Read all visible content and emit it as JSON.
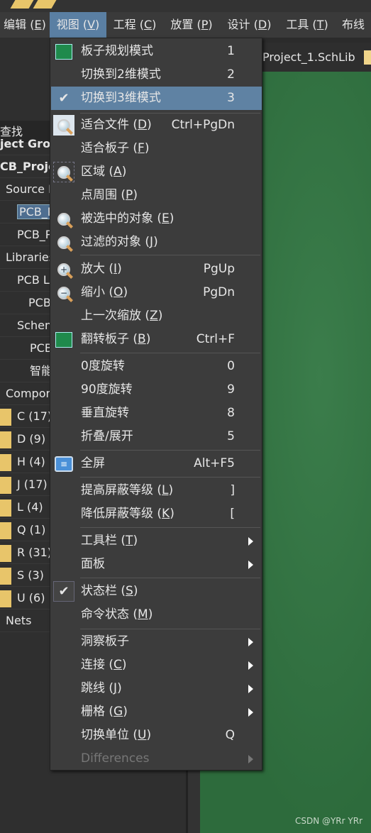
{
  "menubar": [
    {
      "label": "编辑",
      "key": "E"
    },
    {
      "label": "视图",
      "key": "V",
      "active": true
    },
    {
      "label": "工程",
      "key": "C"
    },
    {
      "label": "放置",
      "key": "P"
    },
    {
      "label": "设计",
      "key": "D"
    },
    {
      "label": "工具",
      "key": "T"
    },
    {
      "label": "布线",
      "key": ""
    }
  ],
  "tab": {
    "label": "Project_1.SchLib"
  },
  "left_panel": {
    "search": "查找",
    "items": [
      "ject Grou",
      "CB_Proje",
      "Source D",
      "PCB_P",
      "PCB_P",
      "Libraries",
      "PCB L",
      "PCB",
      "Schem",
      "PCB",
      "智能",
      "Compor",
      "C (17)",
      "D (9)",
      "H (4)",
      "J (17)",
      "L (4)",
      "Q (1)",
      "R (31)",
      "S (3)",
      "U (6)",
      "Nets"
    ]
  },
  "menu": [
    {
      "label": "板子规划模式",
      "key": "",
      "shortcut": "1",
      "icon": "board-planning-icon"
    },
    {
      "label": "切换到2维模式",
      "key": "",
      "shortcut": "2"
    },
    {
      "label": "切换到3维模式",
      "key": "",
      "shortcut": "3",
      "checked": true,
      "highlighted": true
    },
    {
      "label": "适合文件",
      "key": "D",
      "shortcut": "Ctrl+PgDn",
      "icon": "fit-document-icon"
    },
    {
      "label": "适合板子",
      "key": "F",
      "shortcut": ""
    },
    {
      "label": "区域",
      "key": "A",
      "shortcut": "",
      "icon": "zoom-area-icon"
    },
    {
      "label": "点周围",
      "key": "P",
      "shortcut": ""
    },
    {
      "label": "被选中的对象",
      "key": "E",
      "shortcut": "",
      "icon": "zoom-selected-icon"
    },
    {
      "label": "过滤的对象",
      "key": "J",
      "shortcut": "",
      "icon": "zoom-filtered-icon"
    },
    {
      "label": "放大",
      "key": "I",
      "shortcut": "PgUp",
      "icon": "zoom-in-icon"
    },
    {
      "label": "缩小",
      "key": "O",
      "shortcut": "PgDn",
      "icon": "zoom-out-icon"
    },
    {
      "label": "上一次缩放",
      "key": "Z",
      "shortcut": ""
    },
    {
      "label": "翻转板子",
      "key": "B",
      "shortcut": "Ctrl+F",
      "icon": "flip-board-icon"
    },
    {
      "label": "0度旋转",
      "key": "",
      "shortcut": "0"
    },
    {
      "label": "90度旋转",
      "key": "",
      "shortcut": "9"
    },
    {
      "label": "垂直旋转",
      "key": "",
      "shortcut": "8"
    },
    {
      "label": "折叠/展开",
      "key": "",
      "shortcut": "5"
    },
    {
      "label": "全屏",
      "key": "",
      "shortcut": "Alt+F5",
      "icon": "fullscreen-icon"
    },
    {
      "label": "提高屏蔽等级",
      "key": "L",
      "shortcut": "]"
    },
    {
      "label": "降低屏蔽等级",
      "key": "K",
      "shortcut": "["
    },
    {
      "label": "工具栏",
      "key": "T",
      "shortcut": "",
      "submenu": true
    },
    {
      "label": "面板",
      "key": "",
      "shortcut": "",
      "submenu": true
    },
    {
      "label": "状态栏",
      "key": "S",
      "shortcut": "",
      "checked": true
    },
    {
      "label": "命令状态",
      "key": "M",
      "shortcut": ""
    },
    {
      "label": "洞察板子",
      "key": "",
      "shortcut": "",
      "submenu": true
    },
    {
      "label": "连接",
      "key": "C",
      "shortcut": "",
      "submenu": true
    },
    {
      "label": "跳线",
      "key": "J",
      "shortcut": "",
      "submenu": true
    },
    {
      "label": "栅格",
      "key": "G",
      "shortcut": "",
      "submenu": true
    },
    {
      "label": "切换单位",
      "key": "U",
      "shortcut": "Q"
    },
    {
      "label": "Differences",
      "key": "",
      "shortcut": "",
      "submenu": true,
      "disabled": true
    }
  ],
  "watermark": "CSDN @YRr YRr",
  "colors": {
    "highlight": "#5f82a3",
    "menu_bg": "#3c3c3c",
    "canvas": "#2d6b3c"
  }
}
